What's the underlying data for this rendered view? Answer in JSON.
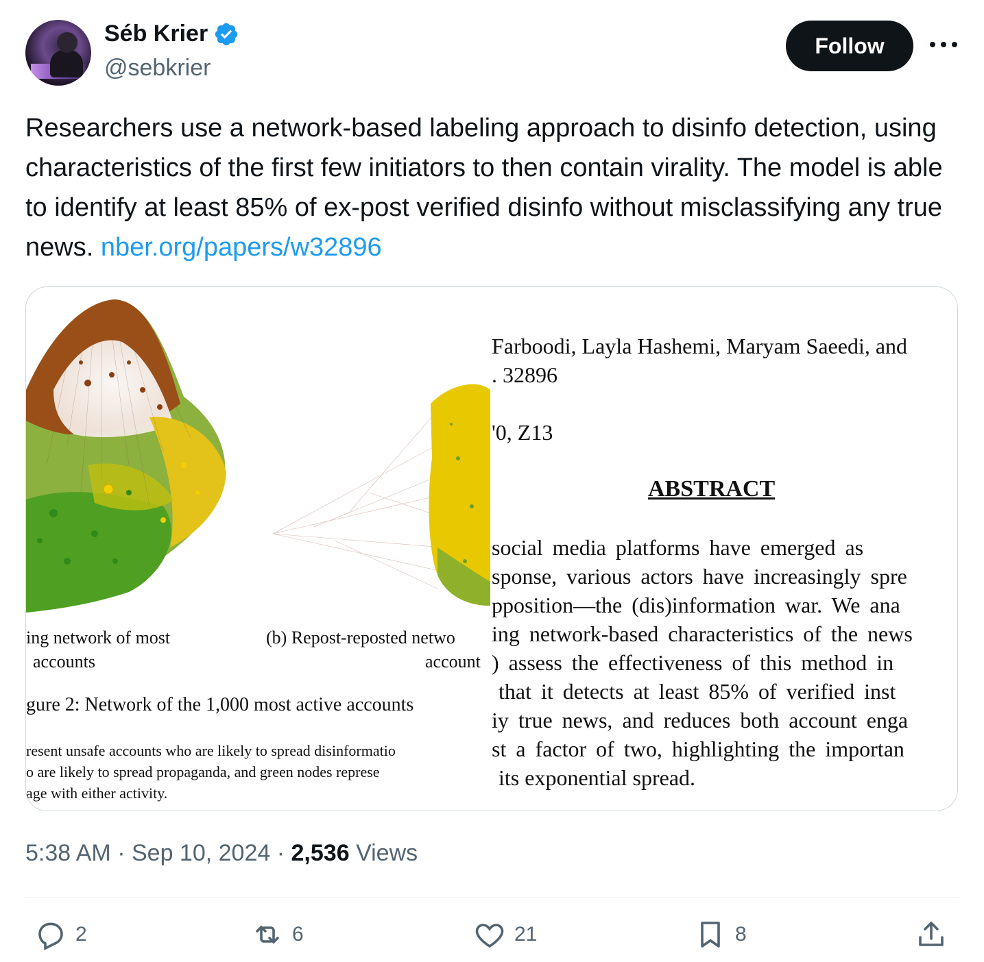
{
  "author": {
    "name": "Séb Krier",
    "handle": "@sebkrier",
    "verified": true
  },
  "follow_label": "Follow",
  "more_icon": "more-horizontal-icon",
  "tweet": {
    "text": "Researchers use a network-based labeling approach to disinfo detection, using characteristics of the first few initiators to then contain virality. The model is able to identify at least 85% of ex-post verified disinfo without misclassifying any true news. ",
    "link": "nber.org/papers/w32896"
  },
  "media": {
    "left_caption_a_line1": "ing network of most",
    "left_caption_a_line2": "accounts",
    "left_caption_b_line1": "(b) Repost-reposted netwo",
    "left_caption_b_line2": "account",
    "figure_caption": "gure 2: Network of the 1,000 most active accounts",
    "footnote_line1": "resent unsafe accounts who are likely to spread disinformatio",
    "footnote_line2": "o are likely to spread propaganda, and green nodes represe",
    "footnote_line3": "age with either activity.",
    "authors_line": "Farboodi, Layla Hashemi, Maryam Saeedi, and",
    "number_line": ". 32896",
    "jel_line": "'0, Z13",
    "abstract_heading": "ABSTRACT",
    "abstract_lines": [
      "social media platforms have emerged as",
      "sponse, various actors have increasingly spre",
      "pposition—the (dis)information war. We ana",
      "ing network-based characteristics of the news",
      ") assess the effectiveness of this method in",
      "that it detects at least 85% of verified inst",
      "iy true news, and reduces both account enga",
      "st a factor of two, highlighting the importan",
      "its exponential spread."
    ],
    "node_colors": {
      "brown": "#a0521e",
      "yellow": "#e8c400",
      "green": "#5fa82a",
      "lime": "#9cc01a"
    }
  },
  "meta": {
    "time": "5:38 AM",
    "date": "Sep 10, 2024",
    "views_count": "2,536",
    "views_label": "Views"
  },
  "actions": {
    "replies": "2",
    "reposts": "6",
    "likes": "21",
    "bookmarks": "8"
  },
  "accent_color": "#1d9bf0"
}
